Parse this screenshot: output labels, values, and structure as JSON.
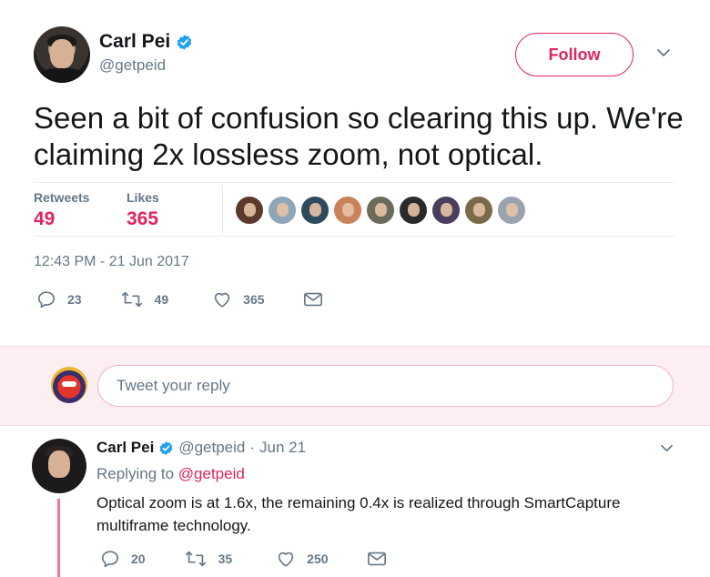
{
  "tweet": {
    "display_name": "Carl Pei",
    "handle": "@getpeid",
    "follow_label": "Follow",
    "text": "Seen a bit of confusion so clearing this up. We're claiming 2x lossless zoom, not optical.",
    "stats": {
      "retweets_label": "Retweets",
      "retweets_value": "49",
      "likes_label": "Likes",
      "likes_value": "365"
    },
    "likers_count_shown": 9,
    "timestamp": "12:43 PM - 21 Jun 2017",
    "actions": {
      "reply_count": "23",
      "retweet_count": "49",
      "like_count": "365"
    }
  },
  "reply_box": {
    "placeholder": "Tweet your reply"
  },
  "reply": {
    "display_name": "Carl Pei",
    "handle": "@getpeid",
    "separator": "·",
    "date": "Jun 21",
    "replying_to_label": "Replying to",
    "replying_to_handle": "@getpeid",
    "text": "Optical zoom is at 1.6x, the remaining 0.4x is realized through SmartCapture multiframe technology.",
    "actions": {
      "reply_count": "20",
      "retweet_count": "35",
      "like_count": "250"
    }
  },
  "colors": {
    "accent": "#e0245e",
    "verified": "#1da1f2",
    "secondary_text": "#657786",
    "reply_box_bg": "#fdeef2",
    "thread_line": "#f0788f"
  },
  "icons": [
    "verified-badge-icon",
    "chevron-down-icon",
    "reply-icon",
    "retweet-icon",
    "heart-icon",
    "envelope-icon"
  ]
}
